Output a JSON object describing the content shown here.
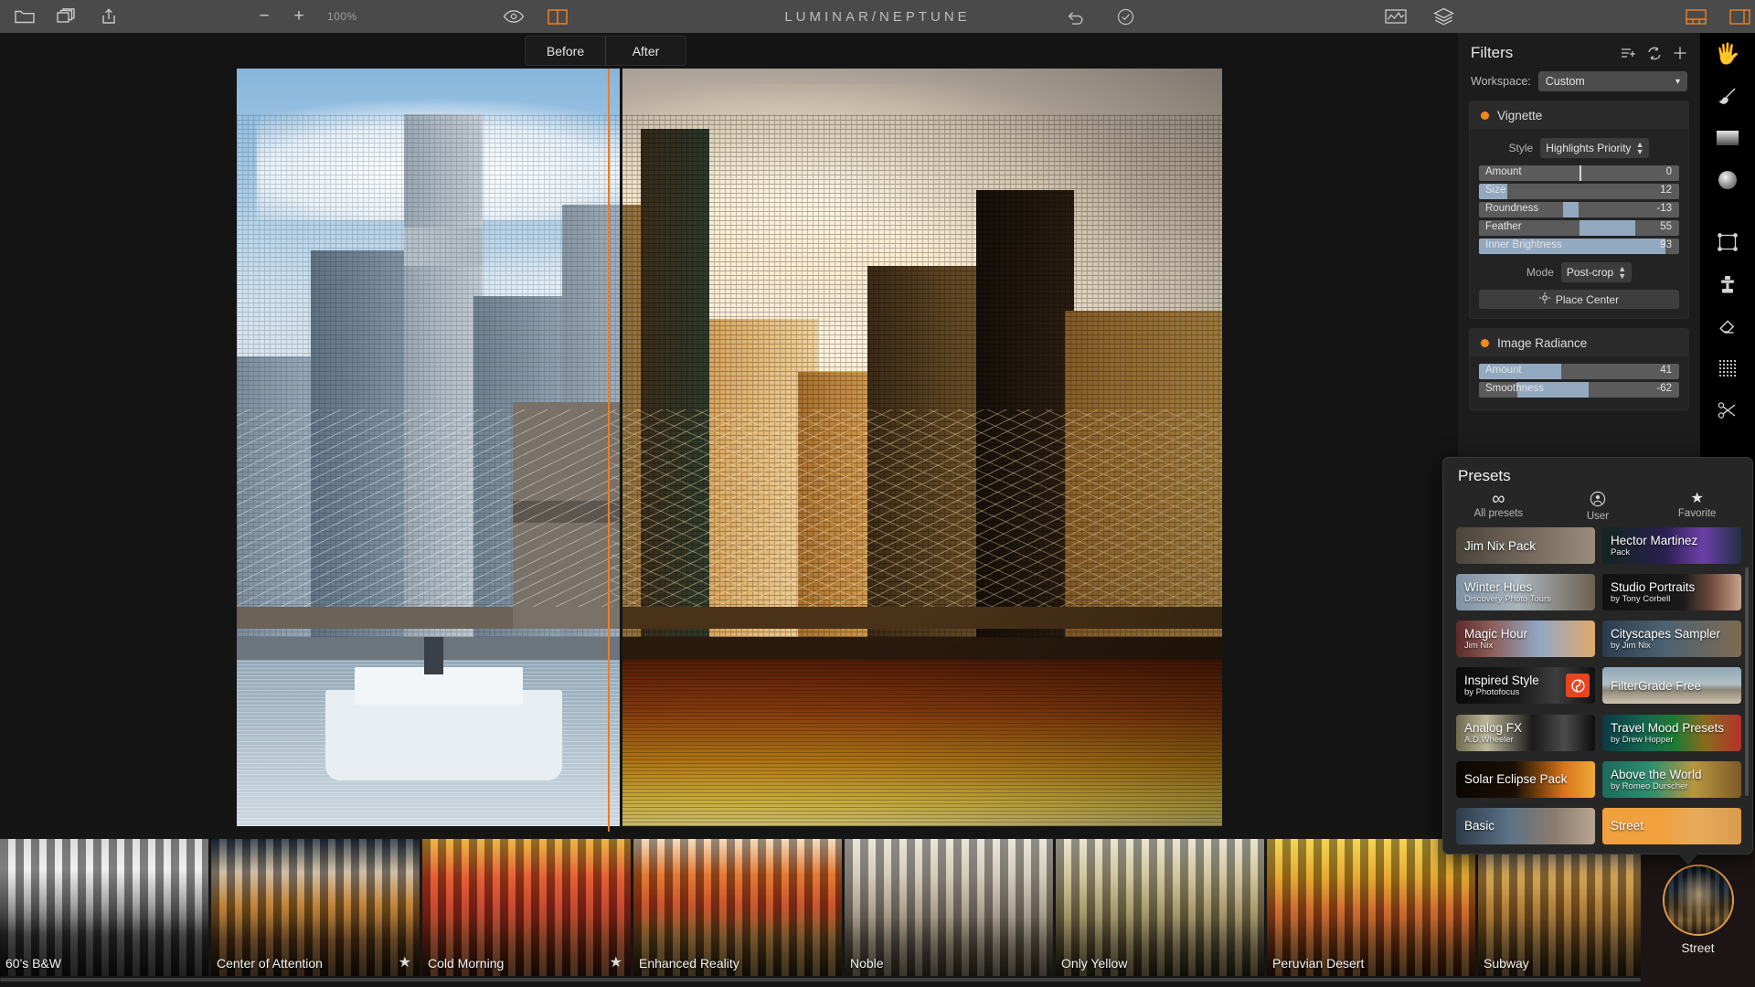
{
  "app": {
    "title": "LUMINAR/NEPTUNE",
    "accent": "#ef8022",
    "panel_bg": "#1c1c1c",
    "slider_fill": "#93a9c0"
  },
  "toolbar": {
    "open_icon": "folder-icon",
    "copies_icon": "duplicate-icon",
    "share_icon": "share-export-icon",
    "zoom_out_label": "−",
    "zoom_in_label": "+",
    "zoom_level": "100%",
    "preview_icon": "eye-icon",
    "compare_icon": "split-view-icon",
    "undo_icon": "undo-arrow-icon",
    "history_icon": "history-clock-icon",
    "histogram_icon": "histogram-icon",
    "layers_icon": "layers-icon",
    "layout_bottom_icon": "panel-bottom-layout-icon",
    "layout_right_icon": "panel-right-layout-icon"
  },
  "compare": {
    "before_label": "Before",
    "after_label": "After"
  },
  "filters": {
    "title": "Filters",
    "add_filter_icon": "add-filter-list-icon",
    "sync_icon": "sync-refresh-icon",
    "plus_icon": "plus-icon",
    "workspace_label": "Workspace:",
    "workspace_value": "Custom",
    "cards": [
      {
        "name": "Vignette",
        "style_label": "Style",
        "style_value": "Highlights Priority",
        "sliders": [
          {
            "label": "Amount",
            "value": "0",
            "fill_pct": 0,
            "mark_pct": 50
          },
          {
            "label": "Size",
            "value": "12",
            "fill_pct": 14,
            "mark_pct": null
          },
          {
            "label": "Roundness",
            "value": "-13",
            "fill_pct": 50,
            "mark_pct": null,
            "fill_start_pct": 42
          },
          {
            "label": "Feather",
            "value": "55",
            "fill_pct": 78,
            "mark_pct": null,
            "fill_start_pct": 50
          },
          {
            "label": "Inner Brightness",
            "value": "93",
            "fill_pct": 93,
            "mark_pct": null
          }
        ],
        "mode_label": "Mode",
        "mode_value": "Post-crop",
        "place_center_label": "Place Center",
        "place_center_icon": "crosshair-icon"
      },
      {
        "name": "Image Radiance",
        "sliders": [
          {
            "label": "Amount",
            "value": "41",
            "fill_pct": 41,
            "mark_pct": null
          },
          {
            "label": "Smoothness",
            "value": "-62",
            "fill_pct": 55,
            "mark_pct": null,
            "fill_start_pct": 19
          }
        ]
      }
    ]
  },
  "tools": [
    {
      "name": "hand-tool-icon",
      "active": true
    },
    {
      "name": "brush-tool-icon",
      "active": false
    },
    {
      "name": "gradient-tool-icon",
      "active": false
    },
    {
      "name": "radial-mask-tool-icon",
      "active": false
    },
    {
      "name": "transform-tool-icon",
      "active": false
    },
    {
      "name": "clone-stamp-tool-icon",
      "active": false
    },
    {
      "name": "eraser-tool-icon",
      "active": false
    },
    {
      "name": "denoise-tool-icon",
      "active": false
    },
    {
      "name": "scissors-tool-icon",
      "active": false
    },
    {
      "name": "plugin-tool-icon",
      "active": false
    }
  ],
  "presets": {
    "title": "Presets",
    "tabs": [
      {
        "label": "All presets",
        "icon": "infinity-icon",
        "active": true
      },
      {
        "label": "User",
        "icon": "user-circle-icon",
        "active": false
      },
      {
        "label": "Favorite",
        "icon": "star-icon",
        "active": false
      }
    ],
    "items": [
      {
        "title": "Jim Nix Pack",
        "subtitle": "",
        "selected": false,
        "badge": ""
      },
      {
        "title": "Hector Martinez",
        "subtitle": "Pack",
        "selected": false,
        "badge": ""
      },
      {
        "title": "Winter Hues",
        "subtitle": "Discovery Photo Tours",
        "selected": false,
        "badge": ""
      },
      {
        "title": "Studio Portraits",
        "subtitle": "by Tony Corbell",
        "selected": false,
        "badge": ""
      },
      {
        "title": "Magic Hour",
        "subtitle": "Jim Nix",
        "selected": false,
        "badge": ""
      },
      {
        "title": "Cityscapes Sampler",
        "subtitle": "by Jim Nix",
        "selected": false,
        "badge": ""
      },
      {
        "title": "Inspired Style",
        "subtitle": "by Photofocus",
        "selected": false,
        "badge": "photofocus-logo-icon"
      },
      {
        "title": "FilterGrade Free",
        "subtitle": "",
        "selected": false,
        "badge": ""
      },
      {
        "title": "Analog FX",
        "subtitle": "A.D.Wheeler",
        "selected": false,
        "badge": ""
      },
      {
        "title": "Travel Mood Presets",
        "subtitle": "by Drew Hopper",
        "selected": false,
        "badge": ""
      },
      {
        "title": "Solar Eclipse Pack",
        "subtitle": "",
        "selected": false,
        "badge": ""
      },
      {
        "title": "Above the World",
        "subtitle": "by Romeo Durscher",
        "selected": false,
        "badge": ""
      },
      {
        "title": "Basic",
        "subtitle": "",
        "selected": false,
        "badge": ""
      },
      {
        "title": "Street",
        "subtitle": "",
        "selected": true,
        "badge": ""
      }
    ]
  },
  "filmstrip": {
    "items": [
      {
        "label": "60's B&W",
        "favorite": false
      },
      {
        "label": "Center of Attention",
        "favorite": true
      },
      {
        "label": "Cold Morning",
        "favorite": true
      },
      {
        "label": "Enhanced Reality",
        "favorite": false
      },
      {
        "label": "Noble",
        "favorite": false
      },
      {
        "label": "Only Yellow",
        "favorite": false
      },
      {
        "label": "Peruvian Desert",
        "favorite": false
      },
      {
        "label": "Subway",
        "favorite": false
      }
    ],
    "selected_category": "Street"
  }
}
